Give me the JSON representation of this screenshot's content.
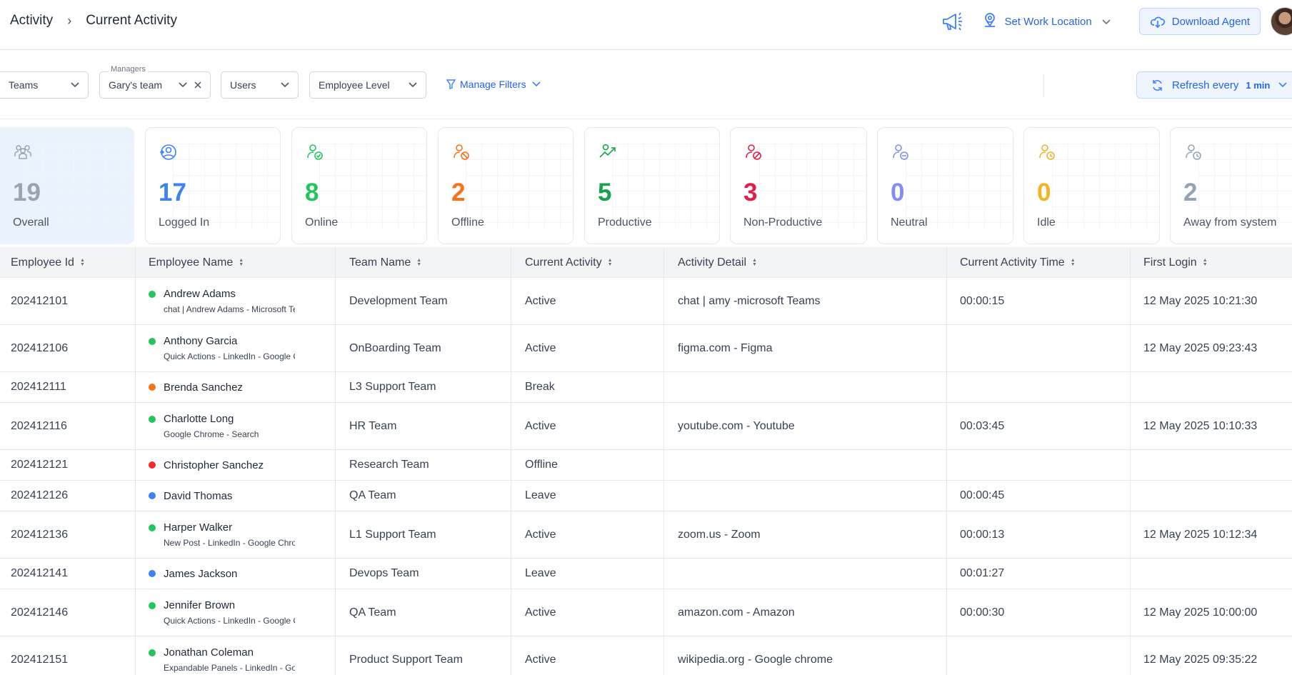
{
  "breadcrumb": {
    "parent": "Activity",
    "separator": "›",
    "current": "Current Activity"
  },
  "header": {
    "announcement_icon": "megaphone-icon",
    "work_location_label": "Set Work Location",
    "download_label": "Download Agent"
  },
  "filters": {
    "teams_label": "Teams",
    "managers_caption": "Managers",
    "managers_value": "Gary's team",
    "users_label": "Users",
    "employee_level_label": "Employee Level",
    "manage_filters_label": "Manage Filters",
    "refresh_label": "Refresh every",
    "refresh_value": "1 min"
  },
  "stats": [
    {
      "value": "19",
      "label": "Overall",
      "color": "#9ca3af"
    },
    {
      "value": "17",
      "label": "Logged In",
      "color": "#3b82f6"
    },
    {
      "value": "8",
      "label": "Online",
      "color": "#22c55e"
    },
    {
      "value": "2",
      "label": "Offline",
      "color": "#f97316"
    },
    {
      "value": "5",
      "label": "Productive",
      "color": "#16a34a"
    },
    {
      "value": "3",
      "label": "Non-Productive",
      "color": "#e11d48"
    },
    {
      "value": "0",
      "label": "Neutral",
      "color": "#818cf8"
    },
    {
      "value": "0",
      "label": "Idle",
      "color": "#f5b323"
    },
    {
      "value": "2",
      "label": "Away from system",
      "color": "#94a3b8"
    }
  ],
  "table": {
    "columns": [
      "Employee Id",
      "Employee Name",
      "Team Name",
      "Current Activity",
      "Activity Detail",
      "Current Activity Time",
      "First Login"
    ],
    "rows": [
      {
        "id": "202412101",
        "name": "Andrew Adams",
        "sub": "chat | Andrew Adams - Microsoft Teams",
        "status": "#22c55e",
        "team": "Development Team",
        "activity": "Active",
        "detail": "chat | amy -microsoft Teams",
        "time": "00:00:15",
        "login": "12 May 2025 10:21:30"
      },
      {
        "id": "202412106",
        "name": "Anthony Garcia",
        "sub": "Quick Actions - LinkedIn - Google Chrome",
        "status": "#22c55e",
        "team": "OnBoarding Team",
        "activity": "Active",
        "detail": "figma.com - Figma",
        "time": "",
        "login": "12 May 2025 09:23:43"
      },
      {
        "id": "202412111",
        "name": "Brenda Sanchez",
        "sub": "",
        "status": "#f97316",
        "team": "L3 Support Team",
        "activity": "Break",
        "detail": "",
        "time": "",
        "login": ""
      },
      {
        "id": "202412116",
        "name": "Charlotte Long",
        "sub": "Google Chrome - Search",
        "status": "#22c55e",
        "team": "HR Team",
        "activity": "Active",
        "detail": "youtube.com - Youtube",
        "time": "00:03:45",
        "login": "12 May 2025 10:10:33"
      },
      {
        "id": "202412121",
        "name": "Christopher Sanchez",
        "sub": "",
        "status": "#ef2b2b",
        "team": "Research Team",
        "activity": "Offline",
        "detail": "",
        "time": "",
        "login": ""
      },
      {
        "id": "202412126",
        "name": "David Thomas",
        "sub": "",
        "status": "#3b82f6",
        "team": "QA Team",
        "activity": "Leave",
        "detail": "",
        "time": "00:00:45",
        "login": ""
      },
      {
        "id": "202412136",
        "name": "Harper Walker",
        "sub": "New Post - LinkedIn - Google Chrome",
        "status": "#22c55e",
        "team": "L1 Support Team",
        "activity": "Active",
        "detail": "zoom.us - Zoom",
        "time": "00:00:13",
        "login": "12 May 2025 10:12:34"
      },
      {
        "id": "202412141",
        "name": "James Jackson",
        "sub": "",
        "status": "#3b82f6",
        "team": "Devops Team",
        "activity": "Leave",
        "detail": "",
        "time": "00:01:27",
        "login": ""
      },
      {
        "id": "202412146",
        "name": "Jennifer Brown",
        "sub": "Quick Actions - LinkedIn - Google Chrome",
        "status": "#22c55e",
        "team": "QA Team",
        "activity": "Active",
        "detail": "amazon.com - Amazon",
        "time": "00:00:30",
        "login": "12 May 2025 10:00:00"
      },
      {
        "id": "202412151",
        "name": "Jonathan Coleman",
        "sub": "Expandable Panels - LinkedIn - Google Chrome",
        "status": "#22c55e",
        "team": "Product Support Team",
        "activity": "Active",
        "detail": "wikipedia.org - Google chrome",
        "time": "",
        "login": "12 May 2025 09:35:22"
      }
    ]
  }
}
